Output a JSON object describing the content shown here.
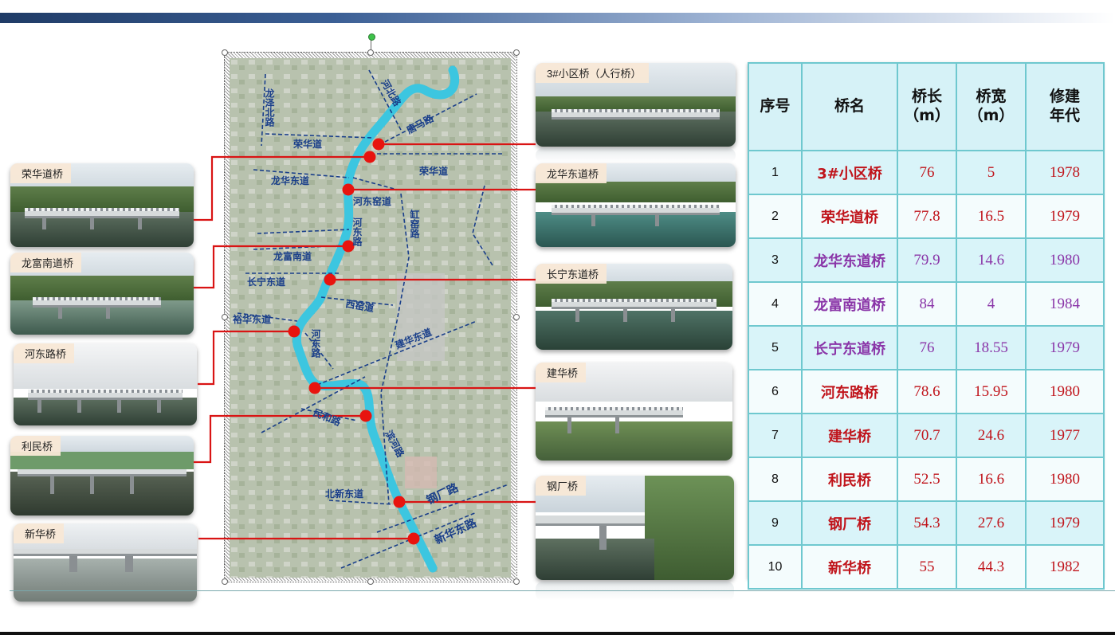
{
  "left_photos": [
    {
      "label": "荣华道桥"
    },
    {
      "label": "龙富南道桥"
    },
    {
      "label": "河东路桥"
    },
    {
      "label": "利民桥"
    },
    {
      "label": "新华桥"
    }
  ],
  "right_photos": [
    {
      "label": "3#小区桥（人行桥）"
    },
    {
      "label": "龙华东道桥"
    },
    {
      "label": "长宁东道桥"
    },
    {
      "label": "建华桥"
    },
    {
      "label": "钢厂桥"
    }
  ],
  "map": {
    "labels": {
      "longze": "龙泽北路",
      "hebei": "河北路",
      "tangma": "唐马路",
      "ronghua1": "荣华道",
      "ronghua2": "荣华道",
      "longhuadong": "龙华东道",
      "hedongyao": "河东窑道",
      "hedonglu": "河东路",
      "gangyao": "缸窑路",
      "longfunan": "龙富南道",
      "changningdong": "长宁东道",
      "xiyao": "西窑道",
      "yuhuadong": "裕华东道",
      "hedong2": "河东路",
      "jianhuadong": "建华东道",
      "minhe": "民和路",
      "binhe": "滨河路",
      "beixindong": "北新东道",
      "gangchang": "钢厂路",
      "xinhuadong": "新华东路"
    },
    "river_color": "#3cc6e0",
    "marker_color": "#e8140f"
  },
  "table": {
    "headers": {
      "no": "序号",
      "name": "桥名",
      "length": "桥长\n（m）",
      "width": "桥宽\n（m）",
      "year": "修建\n年代"
    },
    "rows": [
      {
        "no": "1",
        "name": "3#小区桥",
        "length": "76",
        "width": "5",
        "year": "1978",
        "color": "red"
      },
      {
        "no": "2",
        "name": "荣华道桥",
        "length": "77.8",
        "width": "16.5",
        "year": "1979",
        "color": "red"
      },
      {
        "no": "3",
        "name": "龙华东道桥",
        "length": "79.9",
        "width": "14.6",
        "year": "1980",
        "color": "purple"
      },
      {
        "no": "4",
        "name": "龙富南道桥",
        "length": "84",
        "width": "4",
        "year": "1984",
        "color": "purple"
      },
      {
        "no": "5",
        "name": "长宁东道桥",
        "length": "76",
        "width": "18.55",
        "year": "1979",
        "color": "purple"
      },
      {
        "no": "6",
        "name": "河东路桥",
        "length": "78.6",
        "width": "15.95",
        "year": "1980",
        "color": "red"
      },
      {
        "no": "7",
        "name": "建华桥",
        "length": "70.7",
        "width": "24.6",
        "year": "1977",
        "color": "red"
      },
      {
        "no": "8",
        "name": "利民桥",
        "length": "52.5",
        "width": "16.6",
        "year": "1980",
        "color": "red"
      },
      {
        "no": "9",
        "name": "钢厂桥",
        "length": "54.3",
        "width": "27.6",
        "year": "1979",
        "color": "red"
      },
      {
        "no": "10",
        "name": "新华桥",
        "length": "55",
        "width": "44.3",
        "year": "1982",
        "color": "red"
      }
    ],
    "colors": {
      "red": "#c0141b",
      "purple": "#8a35a8",
      "border": "#6fc8cf"
    }
  }
}
